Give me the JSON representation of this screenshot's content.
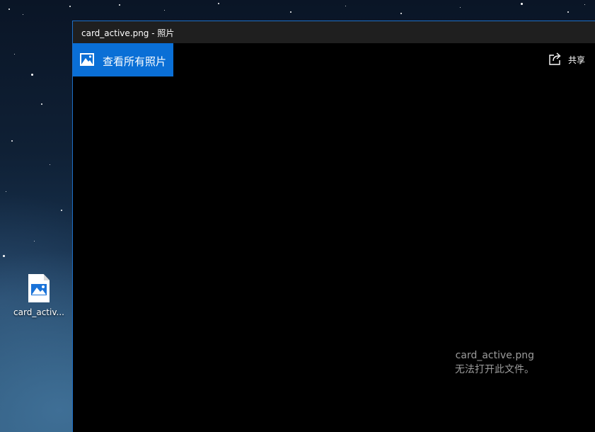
{
  "desktop": {
    "file_label": "card_activ..."
  },
  "window": {
    "title": "card_active.png - 照片",
    "accent_color": "#0a6fd6"
  },
  "toolbar": {
    "view_all_label": "查看所有照片",
    "share_label": "共享"
  },
  "viewer": {
    "filename": "card_active.png",
    "error_message": "无法打开此文件。"
  },
  "icons": {
    "view_all": "photo-icon",
    "share": "share-icon",
    "desktop_file": "image-file-icon"
  }
}
